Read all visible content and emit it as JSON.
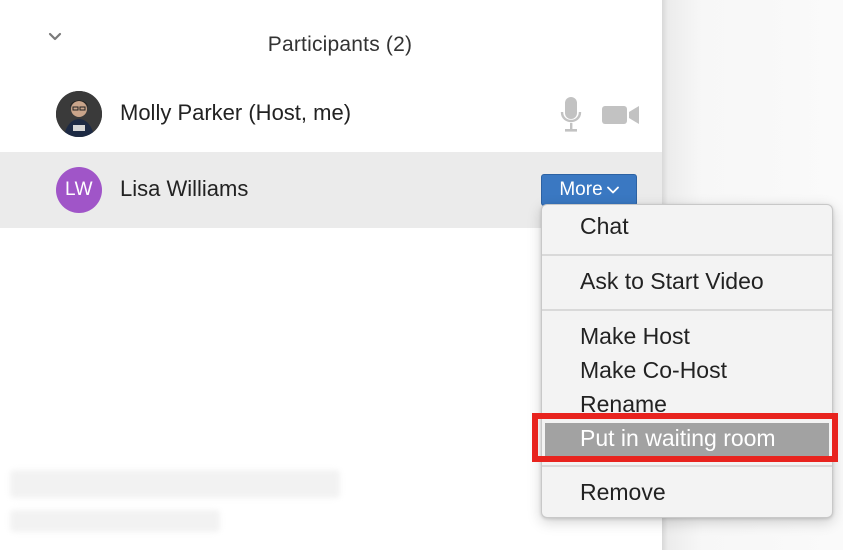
{
  "panel": {
    "title": "Participants (2)",
    "collapse_icon": "chevron-down-icon"
  },
  "participants": [
    {
      "name": "Molly Parker (Host, me)",
      "avatar": "photo",
      "icons": [
        "microphone-icon",
        "video-camera-icon"
      ]
    },
    {
      "name": "Lisa Williams",
      "avatar_initials": "LW",
      "avatar_color": "#a055c8",
      "more_label": "More",
      "selected": true
    }
  ],
  "menu": {
    "items": [
      {
        "label": "Chat"
      },
      {
        "label": "Ask to Start Video"
      },
      {
        "label": "Make Host"
      },
      {
        "label": "Make Co-Host"
      },
      {
        "label": "Rename"
      },
      {
        "label": "Put in waiting room",
        "highlighted": true
      },
      {
        "label": "Remove"
      }
    ]
  },
  "colors": {
    "more_button": "#3a78c2",
    "highlight": "#e8231e",
    "selected_row": "#ebebeb"
  }
}
